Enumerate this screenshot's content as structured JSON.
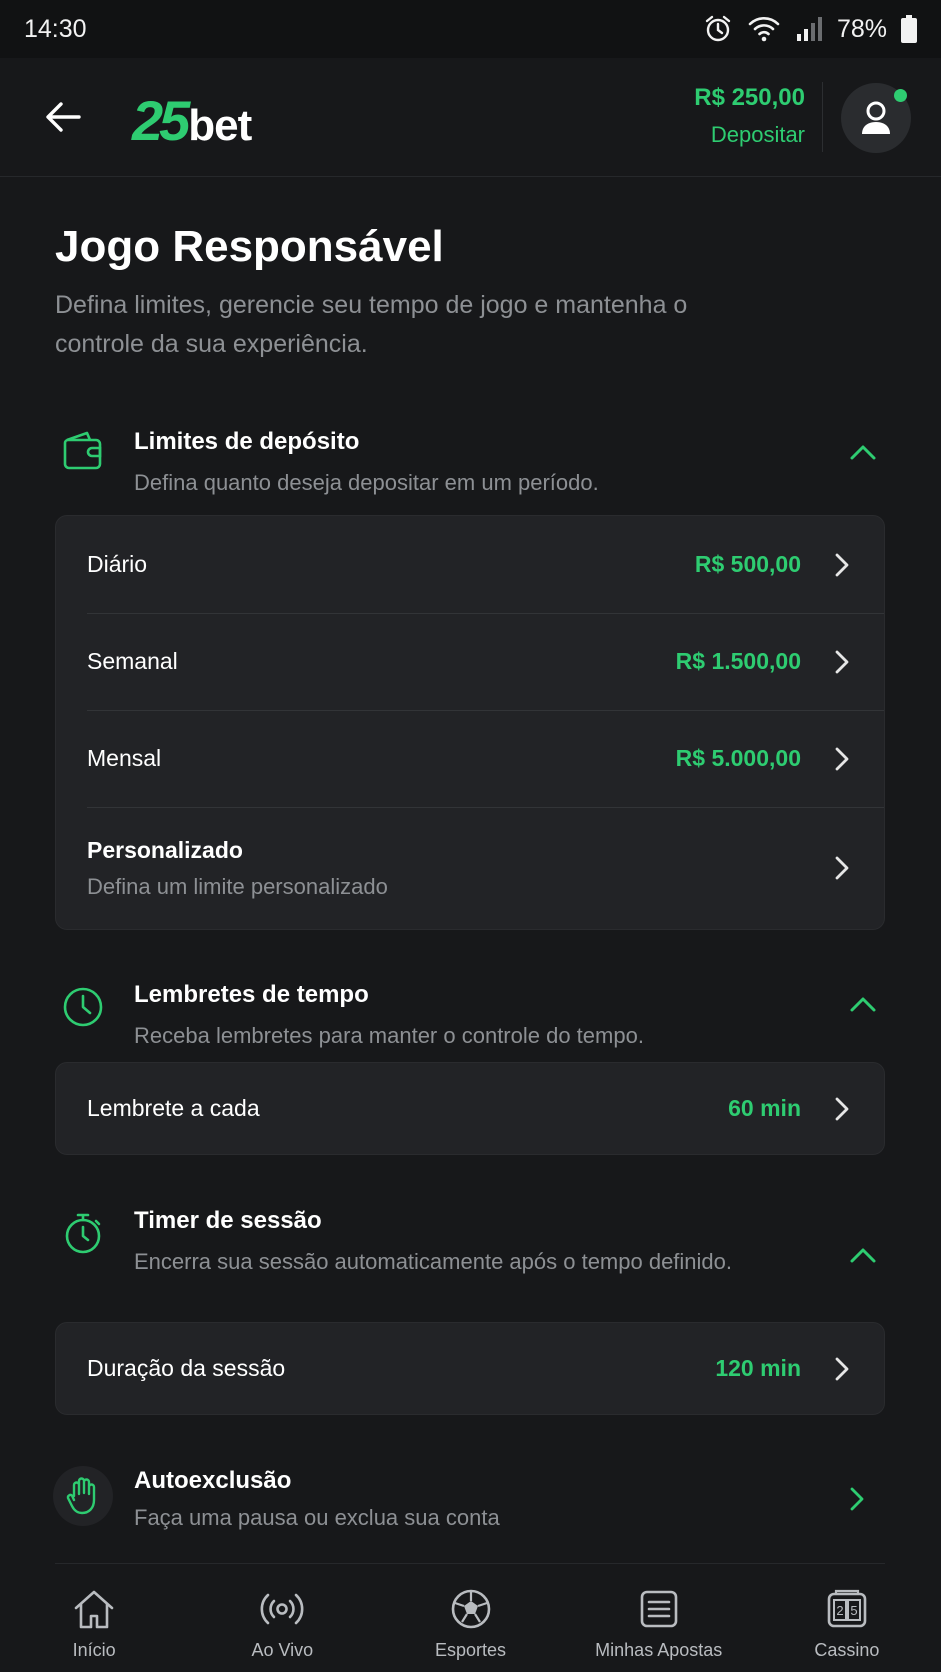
{
  "status_bar": {
    "time": "14:30",
    "battery": "78%"
  },
  "header": {
    "logo_number": "25",
    "logo_word": "bet",
    "balance": "R$ 250,00",
    "deposit_label": "Depositar"
  },
  "page": {
    "title": "Jogo Responsável",
    "subtitle": "Defina limites, gerencie seu tempo de jogo e mantenha o controle da sua experiência."
  },
  "deposit_limits": {
    "title": "Limites de depósito",
    "subtitle": "Defina quanto deseja depositar em um período.",
    "rows": [
      {
        "label": "Diário",
        "value": "R$ 500,00"
      },
      {
        "label": "Semanal",
        "value": "R$ 1.500,00"
      },
      {
        "label": "Mensal",
        "value": "R$ 5.000,00"
      }
    ],
    "custom": {
      "label": "Personalizado",
      "sub": "Defina um limite personalizado"
    }
  },
  "time_reminders": {
    "title": "Lembretes de tempo",
    "subtitle": "Receba lembretes para manter o controle do tempo.",
    "row": {
      "label": "Lembrete a cada",
      "value": "60 min"
    }
  },
  "session_timer": {
    "title": "Timer de sessão",
    "subtitle": "Encerra sua sessão automaticamente após o tempo definido.",
    "row": {
      "label": "Duração da sessão",
      "value": "120 min"
    }
  },
  "self_exclusion": {
    "title": "Autoexclusão",
    "subtitle": "Faça uma pausa ou exclua sua conta"
  },
  "bottom_nav": [
    {
      "label": "Início",
      "icon": "home-icon"
    },
    {
      "label": "Ao Vivo",
      "icon": "live-icon"
    },
    {
      "label": "Esportes",
      "icon": "soccer-ball-icon"
    },
    {
      "label": "Minhas Apostas",
      "icon": "bet-slip-icon"
    },
    {
      "label": "Cassino",
      "icon": "casino-icon"
    }
  ],
  "colors": {
    "accent": "#2ecc71",
    "background": "#17181a",
    "card": "#222326",
    "muted_text": "#8d9094"
  }
}
